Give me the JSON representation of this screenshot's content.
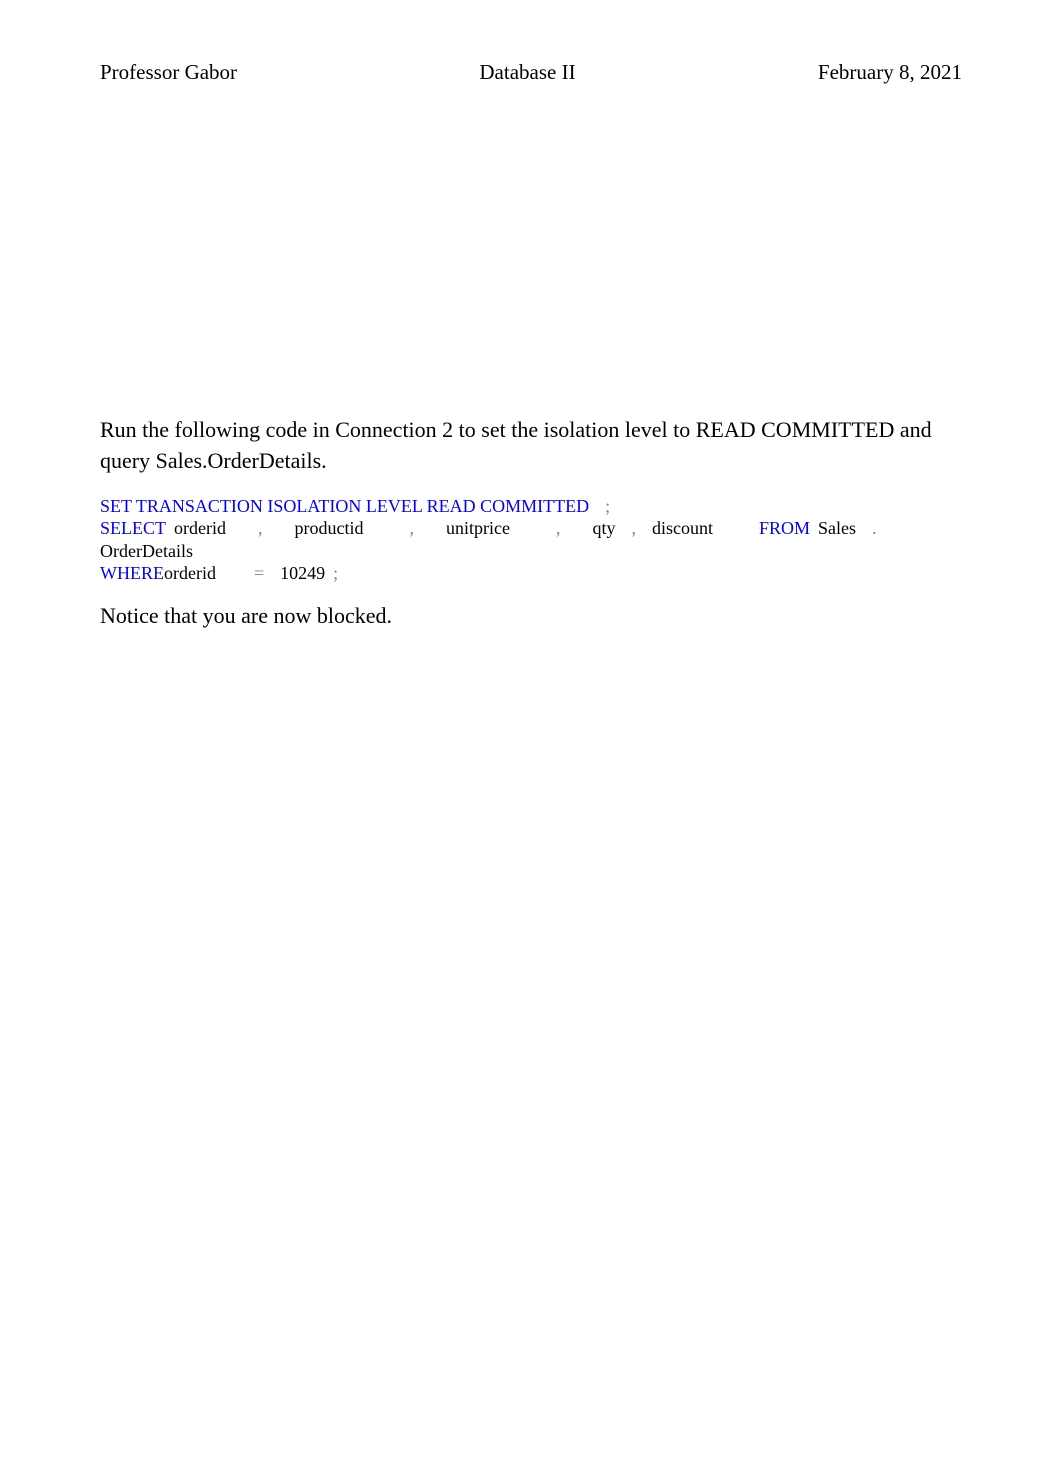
{
  "header": {
    "left": "Professor Gabor",
    "center": "Database II",
    "right": "February 8, 2021"
  },
  "paragraph1": "Run the following code in Connection 2 to set the isolation level to READ COMMITTED and query Sales.OrderDetails.",
  "code": {
    "line1": {
      "kw": "SET TRANSACTION ISOLATION LEVEL READ COMMITTED",
      "semi": ";"
    },
    "line2": {
      "select": "SELECT",
      "col1": "orderid",
      "comma1": ",",
      "col2": "productid",
      "comma2": ",",
      "col3": "unitprice",
      "comma3": ",",
      "col4": "qty",
      "comma4": ",",
      "col5": "discount",
      "from": "FROM",
      "schema": "Sales",
      "dot": ".",
      "table": "OrderDetails"
    },
    "line3": {
      "where": "WHERE",
      "col": "orderid",
      "eq": "=",
      "val": "10249",
      "semi": ";"
    }
  },
  "paragraph2": "Notice that you are now blocked."
}
